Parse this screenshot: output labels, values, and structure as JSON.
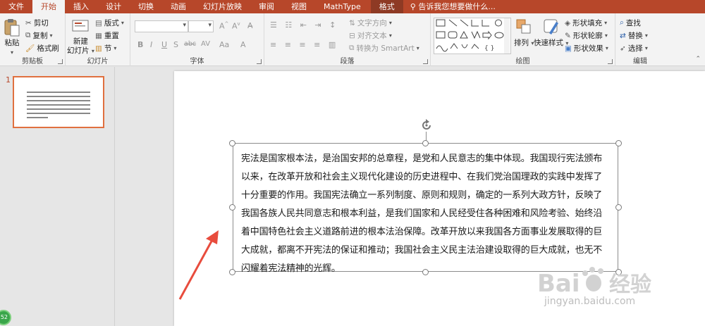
{
  "menu": {
    "tabs": [
      "文件",
      "开始",
      "插入",
      "设计",
      "切换",
      "动画",
      "幻灯片放映",
      "审阅",
      "视图",
      "MathType"
    ],
    "active_tab": "开始",
    "format_tab": "格式",
    "search_placeholder": "告诉我您想要做什么..."
  },
  "ribbon": {
    "clipboard": {
      "label": "剪贴板",
      "paste": "粘贴",
      "cut": "剪切",
      "copy": "复制",
      "format_painter": "格式刷"
    },
    "slides": {
      "label": "幻灯片",
      "new_slide": "新建",
      "new_slide_2": "幻灯片",
      "layout": "版式",
      "reset": "重置",
      "section": "节"
    },
    "font": {
      "label": "字体",
      "bold": "B",
      "italic": "I",
      "underline": "U",
      "strike": "S",
      "shadow": "abc",
      "spacing": "AV",
      "case": "Aa",
      "color": "A"
    },
    "paragraph": {
      "label": "段落",
      "text_direction": "文字方向",
      "align_text": "对齐文本",
      "smartart": "转换为 SmartArt"
    },
    "drawing": {
      "label": "绘图",
      "arrange": "排列",
      "quick_styles": "快速样式",
      "shape_fill": "形状填充",
      "shape_outline": "形状轮廓",
      "shape_effects": "形状效果"
    },
    "editing": {
      "label": "编辑",
      "find": "查找",
      "replace": "替换",
      "select": "选择"
    }
  },
  "thumbnails": [
    {
      "number": "1"
    }
  ],
  "slide": {
    "text_lines": [
      "宪法是国家根本法，是治国安邦的总章程，是党和人民意志的集中体现。我国现行宪法颁布",
      "以来，在改革开放和社会主义现代化建设的历史进程中、在我们党治国理政的实践中发挥了",
      "十分重要的作用。我国宪法确立一系列制度、原则和规则，确定的一系列大政方针，反映了",
      "我国各族人民共同意志和根本利益，是我们国家和人民经受住各种困难和风险考验、始终沿",
      "着中国特色社会主义道路前进的根本法治保障。改革开放以来我国各方面事业发展取得的巨",
      "大成就，都离不开宪法的保证和推动；我国社会主义民主法治建设取得的巨大成就，也无不",
      "闪耀着宪法精神的光辉。"
    ]
  },
  "watermark": {
    "brand": "Bai 经验",
    "url": "jingyan.baidu.com"
  },
  "badge": "52",
  "colors": {
    "accent": "#b7472a",
    "selection": "#e0703f",
    "arrow": "#e84c3d"
  }
}
